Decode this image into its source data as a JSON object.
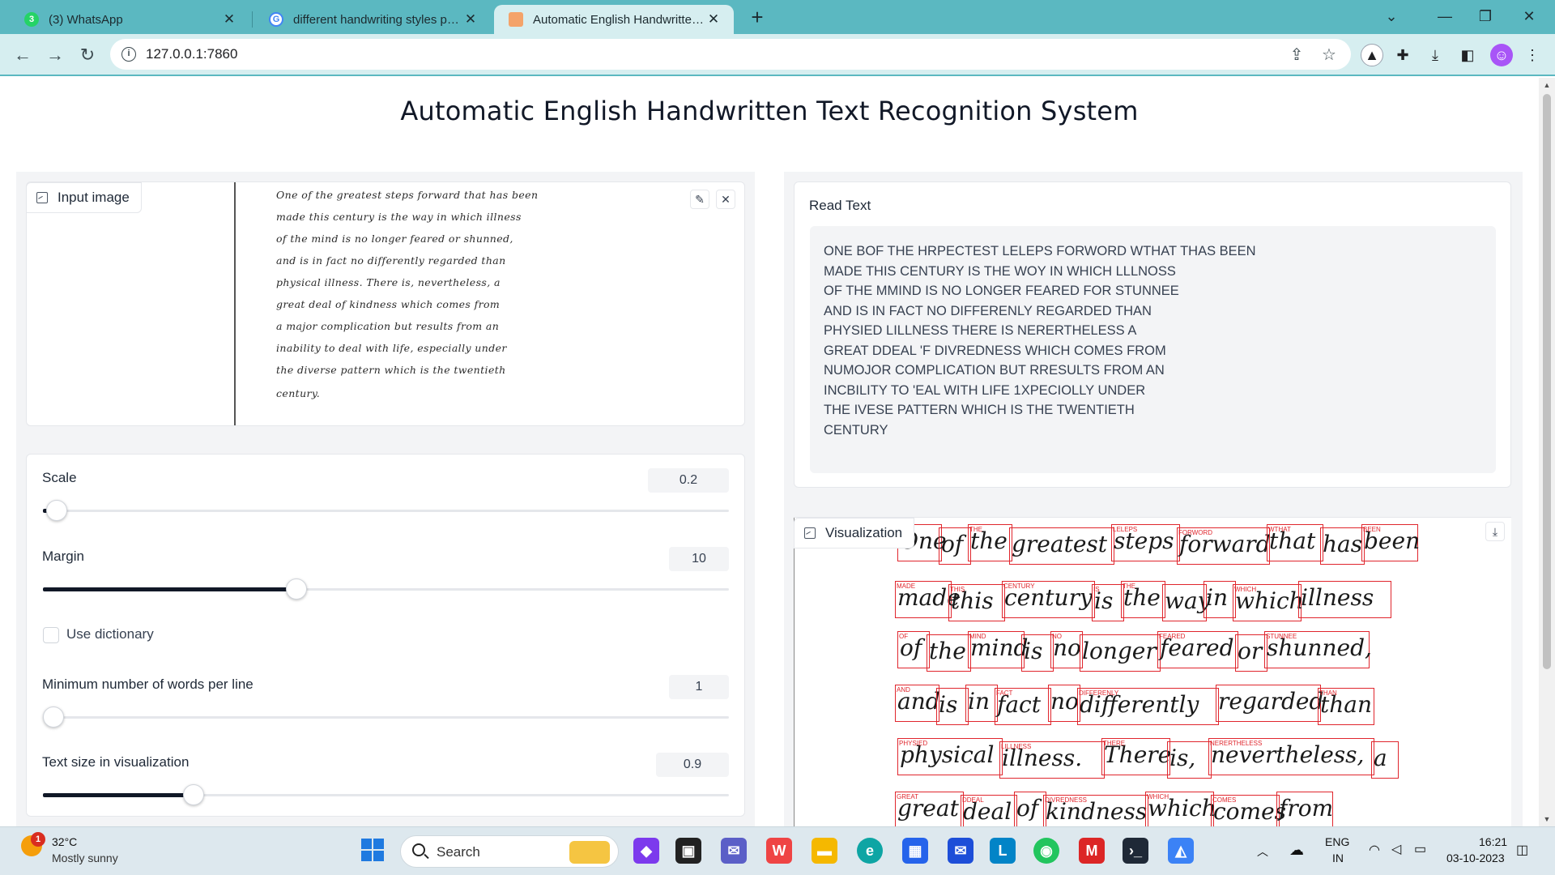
{
  "browser": {
    "tabs": [
      {
        "title": "(3) WhatsApp",
        "favicon": "whatsapp-icon",
        "badge": "3"
      },
      {
        "title": "different handwriting styles para",
        "favicon": "google-icon"
      },
      {
        "title": "Automatic English Handwritten T",
        "favicon": "gradio-icon",
        "active": true
      }
    ],
    "url": "127.0.0.1:7860",
    "theme_color": "#5bb8c1"
  },
  "app": {
    "title": "Automatic English Handwritten Text Recognition System",
    "input_image_label": "Input image",
    "input_image_lines": [
      "One of the greatest steps forward that has been",
      "made this century is the way in which illness",
      "of the mind is no longer feared or shunned,",
      "and is in fact no differently regarded than",
      "physical illness. There is, nevertheless, a",
      "great deal of kindness which comes from",
      "a major complication but results from an",
      "inability to deal with life, especially under",
      "the diverse pattern which is the twentieth",
      "century."
    ],
    "controls": {
      "scale": {
        "label": "Scale",
        "value": "0.2",
        "fraction": 0.02
      },
      "margin": {
        "label": "Margin",
        "value": "10",
        "fraction": 0.37
      },
      "use_dictionary": {
        "label": "Use dictionary",
        "checked": false
      },
      "min_words": {
        "label": "Minimum number of words per line",
        "value": "1",
        "fraction": 0.0
      },
      "text_size": {
        "label": "Text size in visualization",
        "value": "0.9",
        "fraction": 0.22
      }
    },
    "read_text": {
      "label": "Read Text",
      "lines": [
        "ONE BOF THE HRPECTEST LELEPS FORWORD WTHAT THAS BEEN",
        "MADE THIS CENTURY IS THE WOY IN WHICH LLLNOSS",
        "OF THE MMIND IS NO LONGER FEARED FOR STUNNEE",
        "AND IS IN FACT NO DIFFERENLY REGARDED THAN",
        "PHYSIED LILLNESS THERE IS NERERTHELESS A",
        "GREAT DDEAL 'F DIVREDNESS WHICH COMES FROM",
        "NUMOJOR COMPLICATION BUT RRESULTS FROM AN",
        "INCBILITY TO 'EAL WITH LIFE 1XPECIOLLY UNDER",
        "THE IVESE PATTERN WHICH IS THE TWENTIETH",
        "CENTURY"
      ]
    },
    "visualization": {
      "label": "Visualization",
      "box_color": "#e0262d",
      "rows": [
        [
          "One",
          "of",
          "the",
          "greatest",
          "steps",
          "forward",
          "that",
          "has",
          "been"
        ],
        [
          "made",
          "this",
          "century",
          "is",
          "the",
          "way",
          "in",
          "which",
          "illness"
        ],
        [
          "of",
          "the",
          "mind",
          "is",
          "no",
          "longer",
          "feared",
          "or",
          "shunned,"
        ],
        [
          "and",
          "is",
          "in",
          "fact",
          "no",
          "differently",
          "regarded",
          "than"
        ],
        [
          "physical",
          "illness.",
          "There",
          "is,",
          "nevertheless,",
          "a"
        ],
        [
          "great",
          "deal",
          "of",
          "kindness",
          "which",
          "comes",
          "from"
        ]
      ],
      "row_tags": [
        [
          "",
          "",
          "THE",
          "",
          "LELEPS",
          "FORWORD",
          "WTHAT",
          "",
          "BEEN"
        ],
        [
          "MADE",
          "THIS",
          "CENTURY",
          "IS",
          "THE",
          "",
          "",
          "WHICH",
          ""
        ],
        [
          "OF",
          "",
          "MIND",
          "",
          "NO",
          "",
          "FEARED",
          "",
          "STUNNEE"
        ],
        [
          "AND",
          "",
          "",
          "FACT",
          "",
          "DIFFERENLY",
          "",
          "THAN"
        ],
        [
          "PHYSIED",
          "LILLNESS",
          "THERE",
          "",
          "NERERTHELESS",
          ""
        ],
        [
          "GREAT",
          "DDEAL",
          "",
          "DIVREDNESS",
          "WHICH",
          "COMES",
          ""
        ]
      ]
    }
  },
  "taskbar": {
    "temperature": "32°C",
    "weather": "Mostly sunny",
    "weather_badge": "1",
    "search_label": "Search",
    "language": "ENG",
    "region": "IN",
    "time": "16:21",
    "date": "03-10-2023"
  }
}
